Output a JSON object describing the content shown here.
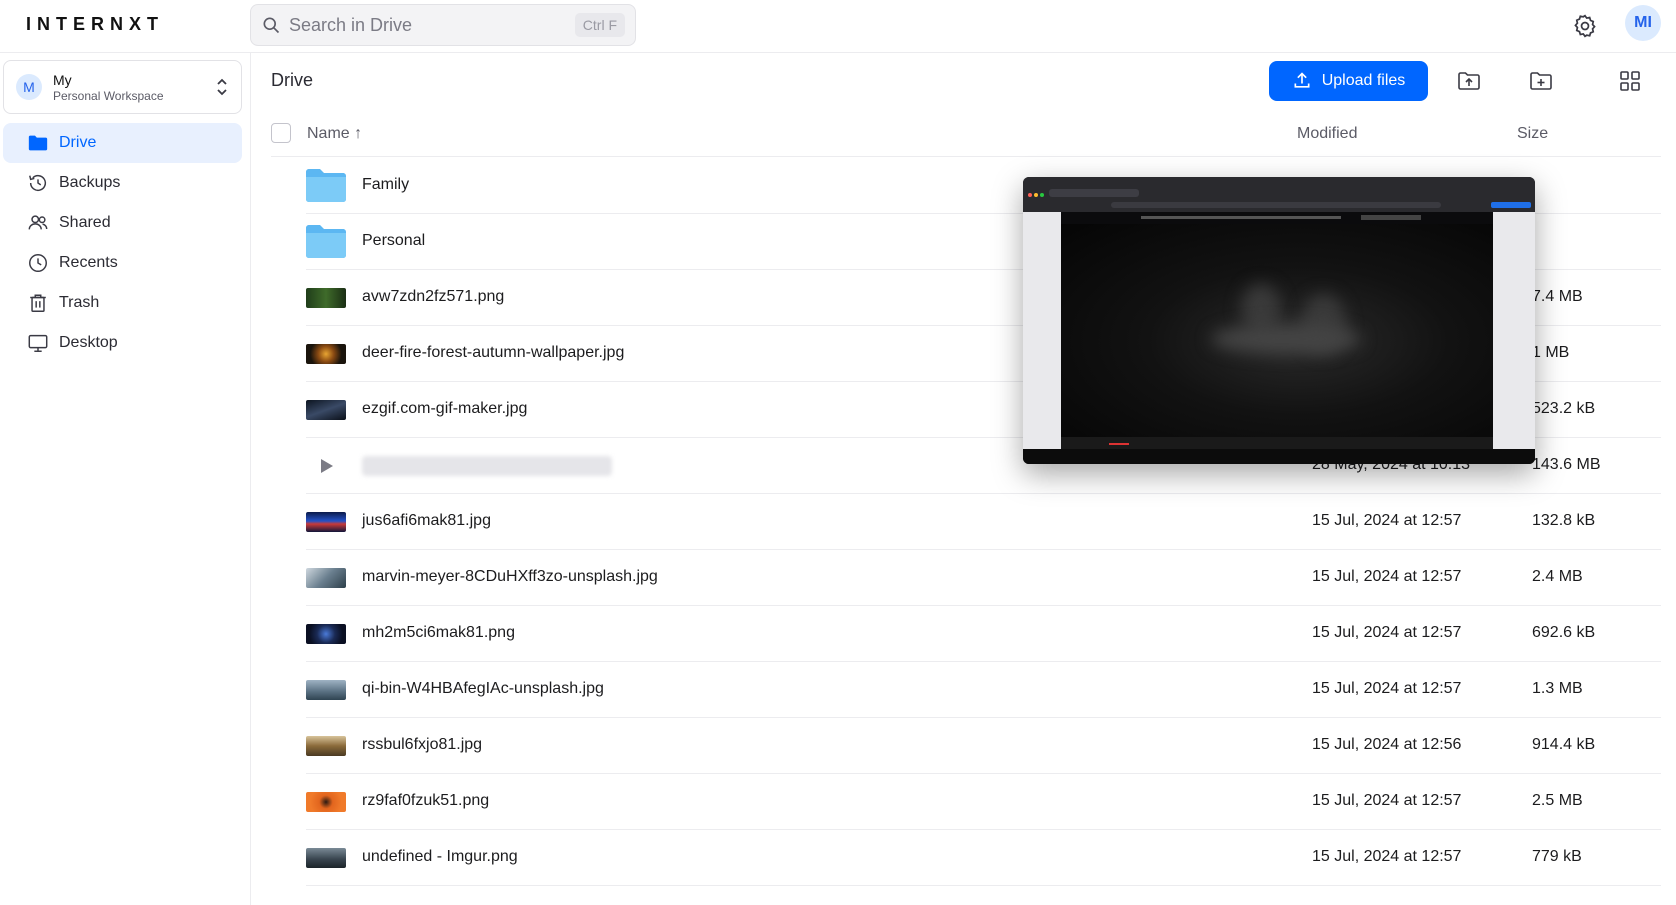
{
  "app": {
    "logo": "INTERNXT",
    "user_initials": "MI"
  },
  "search": {
    "placeholder": "Search in Drive",
    "shortcut": "Ctrl F"
  },
  "workspace": {
    "initial": "M",
    "name": "My",
    "subtitle": "Personal Workspace"
  },
  "sidebar": {
    "items": [
      {
        "label": "Drive",
        "icon": "folder-icon",
        "active": true
      },
      {
        "label": "Backups",
        "icon": "history-icon",
        "active": false
      },
      {
        "label": "Shared",
        "icon": "users-icon",
        "active": false
      },
      {
        "label": "Recents",
        "icon": "clock-icon",
        "active": false
      },
      {
        "label": "Trash",
        "icon": "trash-icon",
        "active": false
      },
      {
        "label": "Desktop",
        "icon": "desktop-icon",
        "active": false
      }
    ]
  },
  "main": {
    "breadcrumb": "Drive",
    "upload_label": "Upload files",
    "columns": {
      "name": "Name ↑",
      "modified": "Modified",
      "size": "Size"
    }
  },
  "files": [
    {
      "name": "Family",
      "type": "folder",
      "modified": "",
      "size": ""
    },
    {
      "name": "Personal",
      "type": "folder",
      "modified": "",
      "size": ""
    },
    {
      "name": "avw7zdn2fz571.png",
      "type": "image",
      "modified": "",
      "size": "7.4 MB"
    },
    {
      "name": "deer-fire-forest-autumn-wallpaper.jpg",
      "type": "image",
      "modified": "",
      "size": "1 MB"
    },
    {
      "name": "ezgif.com-gif-maker.jpg",
      "type": "image",
      "modified": "",
      "size": "523.2 kB"
    },
    {
      "name": "",
      "type": "video",
      "modified": "28 May, 2024 at 10:13",
      "size": "143.6 MB"
    },
    {
      "name": "jus6afi6mak81.jpg",
      "type": "image",
      "modified": "15 Jul, 2024 at 12:57",
      "size": "132.8 kB"
    },
    {
      "name": "marvin-meyer-8CDuHXff3zo-unsplash.jpg",
      "type": "image",
      "modified": "15 Jul, 2024 at 12:57",
      "size": "2.4 MB"
    },
    {
      "name": "mh2m5ci6mak81.png",
      "type": "image",
      "modified": "15 Jul, 2024 at 12:57",
      "size": "692.6 kB"
    },
    {
      "name": "qi-bin-W4HBAfegIAc-unsplash.jpg",
      "type": "image",
      "modified": "15 Jul, 2024 at 12:57",
      "size": "1.3 MB"
    },
    {
      "name": "rssbul6fxjo81.jpg",
      "type": "image",
      "modified": "15 Jul, 2024 at 12:56",
      "size": "914.4 kB"
    },
    {
      "name": "rz9faf0fzuk51.png",
      "type": "image",
      "modified": "15 Jul, 2024 at 12:57",
      "size": "2.5 MB"
    },
    {
      "name": "undefined - Imgur.png",
      "type": "image",
      "modified": "15 Jul, 2024 at 12:57",
      "size": "779 kB"
    }
  ],
  "colors": {
    "accent": "#0066ff",
    "active_nav_bg": "#e8f0fe",
    "folder": "#6ec1f5"
  }
}
